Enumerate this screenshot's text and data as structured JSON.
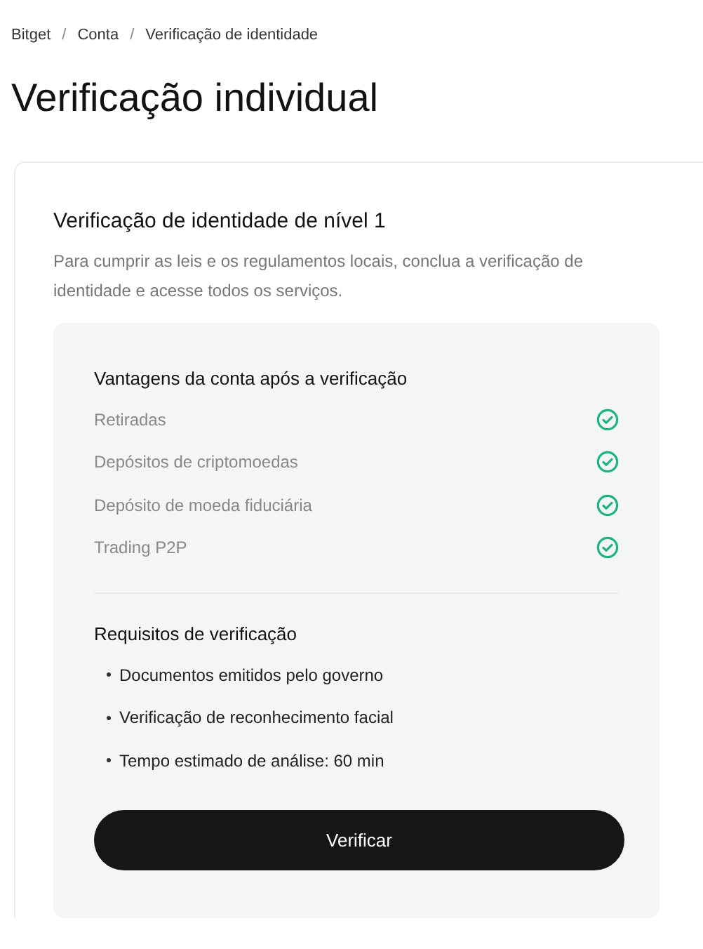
{
  "breadcrumb": [
    "Bitget",
    "Conta",
    "Verificação de identidade"
  ],
  "breadcrumb_separator": "/",
  "page_title": "Verificação individual",
  "card": {
    "title": "Verificação de identidade de nível 1",
    "description": "Para cumprir as leis e os regulamentos locais, conclua a verificação de identidade e acesse todos os serviços.",
    "benefits": {
      "title": "Vantagens da conta após a verificação",
      "items": [
        "Retiradas",
        "Depósitos de criptomoedas",
        "Depósito de moeda fiduciária",
        "Trading P2P"
      ]
    },
    "requirements": {
      "title": "Requisitos de verificação",
      "items": [
        "Documentos emitidos pelo governo",
        "Verificação de reconhecimento facial",
        "Tempo estimado de análise: 60 min"
      ]
    },
    "button": "Verificar"
  }
}
